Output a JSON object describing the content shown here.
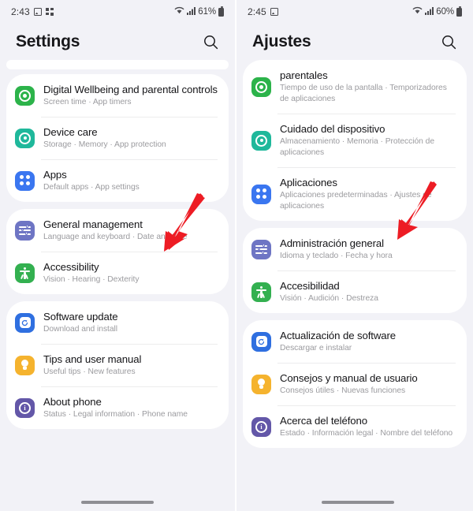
{
  "left": {
    "status_bar": {
      "time": "2:43",
      "battery": "61%",
      "icons": [
        "image-icon",
        "dots-grid-icon",
        "wifi-icon",
        "signal-icon",
        "battery-icon"
      ]
    },
    "header": {
      "title": "Settings",
      "search_icon": "search-icon"
    },
    "groups": [
      {
        "items": [
          {
            "title": "Digital Wellbeing and parental controls",
            "subtitle": "Screen time  ·  App timers",
            "icon": "wellbeing-icon",
            "color": "#2CB34A"
          },
          {
            "title": "Device care",
            "subtitle": "Storage  ·  Memory  ·  App protection",
            "icon": "device-care-icon",
            "color": "#1FB89B"
          },
          {
            "title": "Apps",
            "subtitle": "Default apps  ·  App settings",
            "icon": "apps-icon",
            "color": "#3A76F0"
          }
        ]
      },
      {
        "items": [
          {
            "title": "General management",
            "subtitle": "Language and keyboard  ·  Date and time",
            "icon": "sliders-icon",
            "color": "#6E75C4"
          },
          {
            "title": "Accessibility",
            "subtitle": "Vision  ·  Hearing  ·  Dexterity",
            "icon": "accessibility-icon",
            "color": "#33B050"
          }
        ]
      },
      {
        "items": [
          {
            "title": "Software update",
            "subtitle": "Download and install",
            "icon": "software-update-icon",
            "color": "#2F6FE0"
          },
          {
            "title": "Tips and user manual",
            "subtitle": "Useful tips  ·  New features",
            "icon": "bulb-icon",
            "color": "#F5B32E"
          },
          {
            "title": "About phone",
            "subtitle": "Status  ·  Legal information  ·  Phone name",
            "icon": "info-icon",
            "color": "#6357A8"
          }
        ]
      }
    ],
    "annotation": {
      "arrow": "red-arrow",
      "color": "#ED1C24",
      "points_to": "General management"
    }
  },
  "right": {
    "status_bar": {
      "time": "2:45",
      "battery": "60%",
      "icons": [
        "image-icon",
        "wifi-icon",
        "signal-icon",
        "battery-icon"
      ]
    },
    "header": {
      "title": "Ajustes",
      "search_icon": "search-icon"
    },
    "groups": [
      {
        "items": [
          {
            "title": "parentales",
            "subtitle": "Tiempo de uso de la pantalla  ·  Temporizadores de aplicaciones",
            "icon": "wellbeing-icon",
            "color": "#2CB34A"
          },
          {
            "title": "Cuidado del dispositivo",
            "subtitle": "Almacenamiento  ·  Memoria  ·  Protección de aplicaciones",
            "icon": "device-care-icon",
            "color": "#1FB89B"
          },
          {
            "title": "Aplicaciones",
            "subtitle": "Aplicaciones predeterminadas  ·  Ajustes de aplicaciones",
            "icon": "apps-icon",
            "color": "#3A76F0"
          }
        ]
      },
      {
        "items": [
          {
            "title": "Administración general",
            "subtitle": "Idioma y teclado  ·  Fecha y hora",
            "icon": "sliders-icon",
            "color": "#6E75C4"
          },
          {
            "title": "Accesibilidad",
            "subtitle": "Visión  ·  Audición  ·  Destreza",
            "icon": "accessibility-icon",
            "color": "#33B050"
          }
        ]
      },
      {
        "items": [
          {
            "title": "Actualización de software",
            "subtitle": "Descargar e instalar",
            "icon": "software-update-icon",
            "color": "#2F6FE0"
          },
          {
            "title": "Consejos y manual de usuario",
            "subtitle": "Consejos útiles  ·  Nuevas funciones",
            "icon": "bulb-icon",
            "color": "#F5B32E"
          },
          {
            "title": "Acerca del teléfono",
            "subtitle": "Estado  ·  Información legal  ·  Nombre del teléfono",
            "icon": "info-icon",
            "color": "#6357A8"
          }
        ]
      }
    ],
    "annotation": {
      "arrow": "red-arrow",
      "color": "#ED1C24",
      "points_to": "Administración general"
    }
  }
}
